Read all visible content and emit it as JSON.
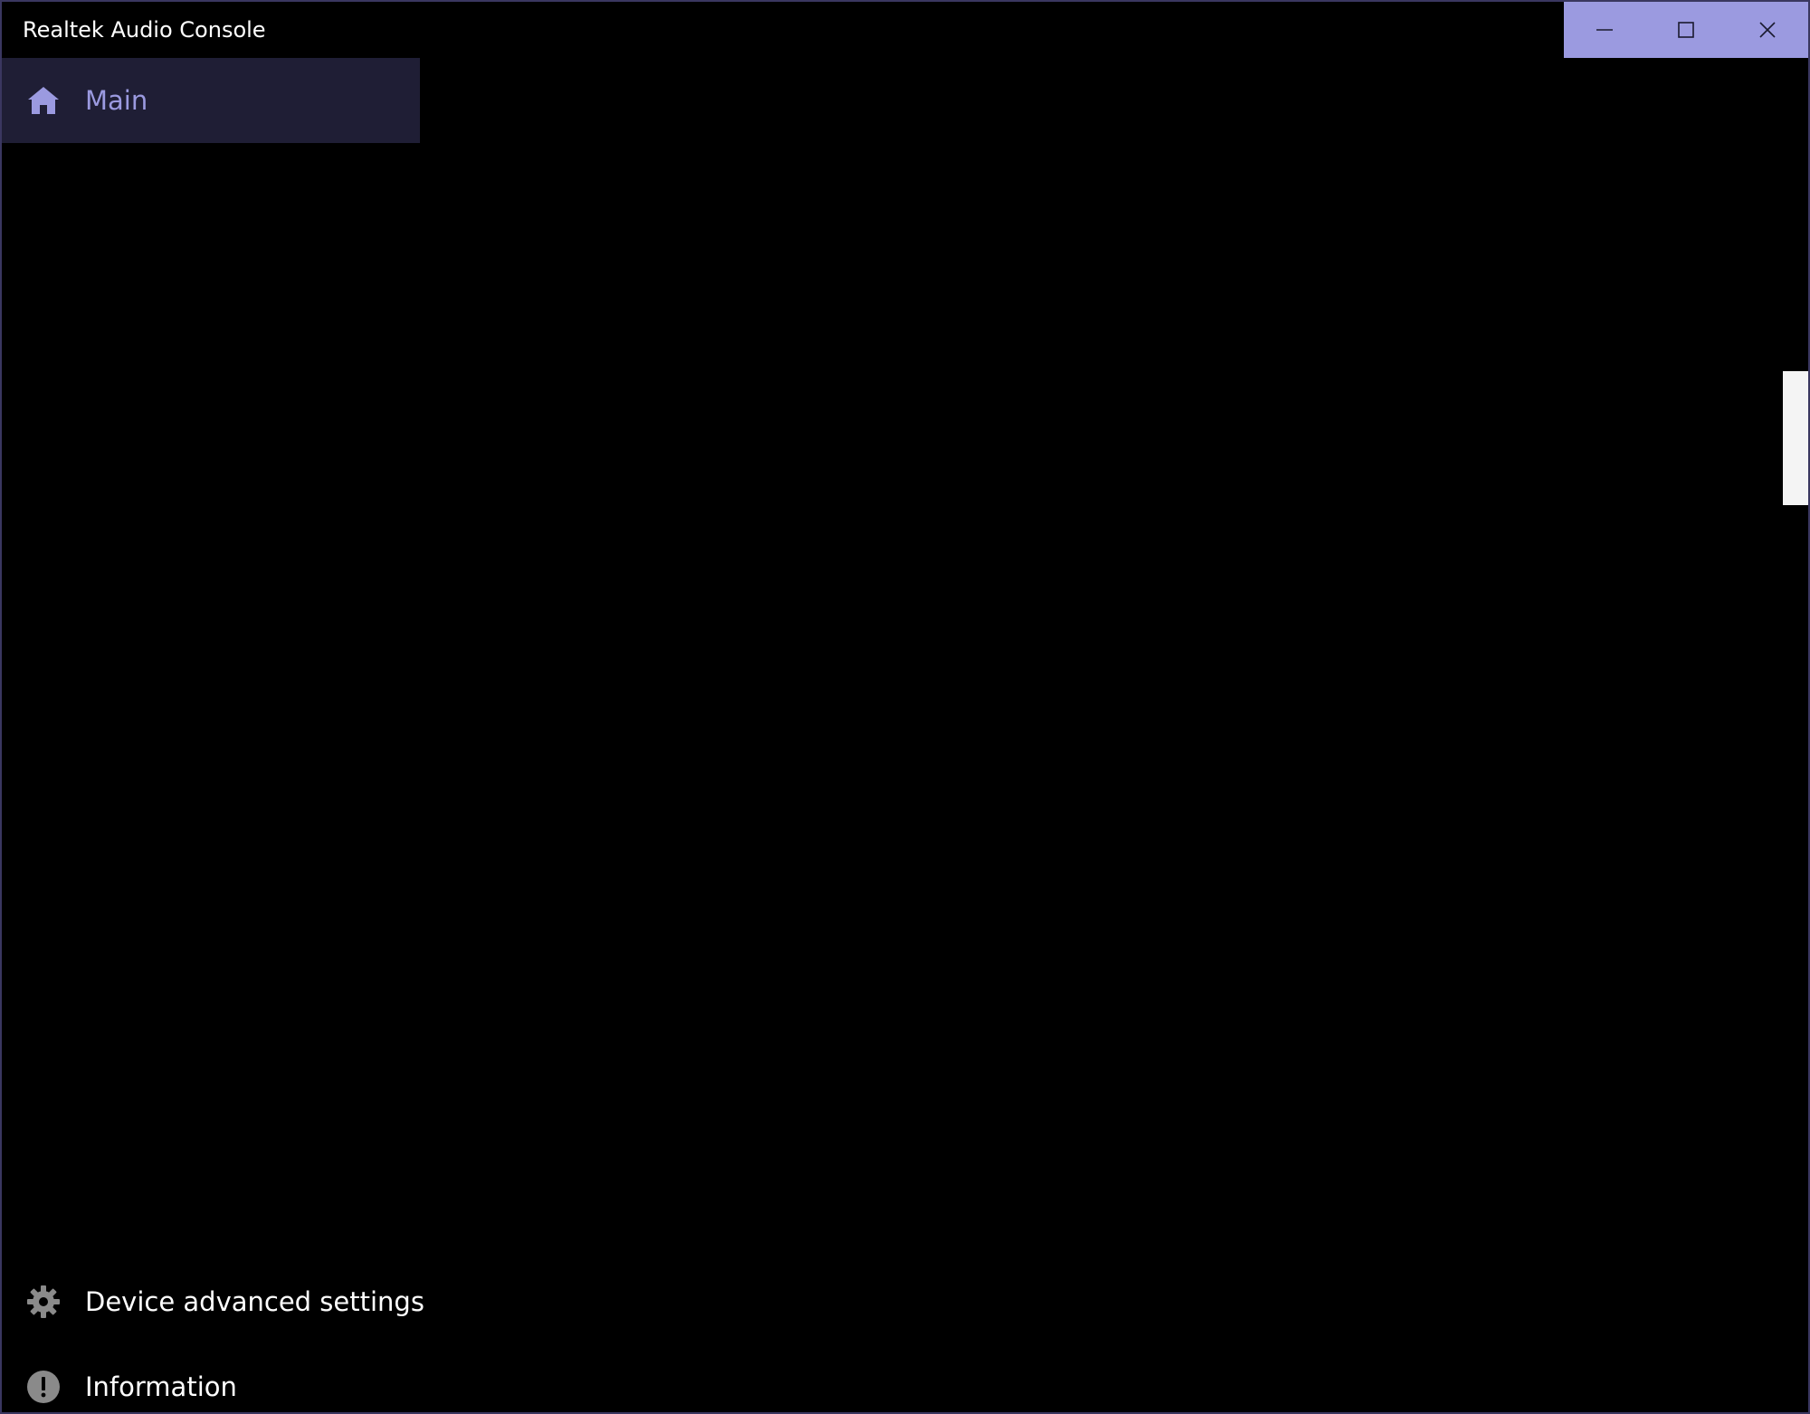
{
  "window": {
    "title": "Realtek Audio Console",
    "accent_color": "#9b9ae0",
    "controls": [
      {
        "name": "minimize-button",
        "icon": "minimize-icon"
      },
      {
        "name": "maximize-button",
        "icon": "maximize-icon"
      },
      {
        "name": "close-button",
        "icon": "close-icon"
      }
    ]
  },
  "sidebar": {
    "items": [
      {
        "label": "Main",
        "icon": "home-icon",
        "selected": true
      },
      {
        "label": "Device advanced settings",
        "icon": "gear-icon",
        "selected": false
      },
      {
        "label": "Information",
        "icon": "info-icon",
        "selected": false
      }
    ]
  }
}
